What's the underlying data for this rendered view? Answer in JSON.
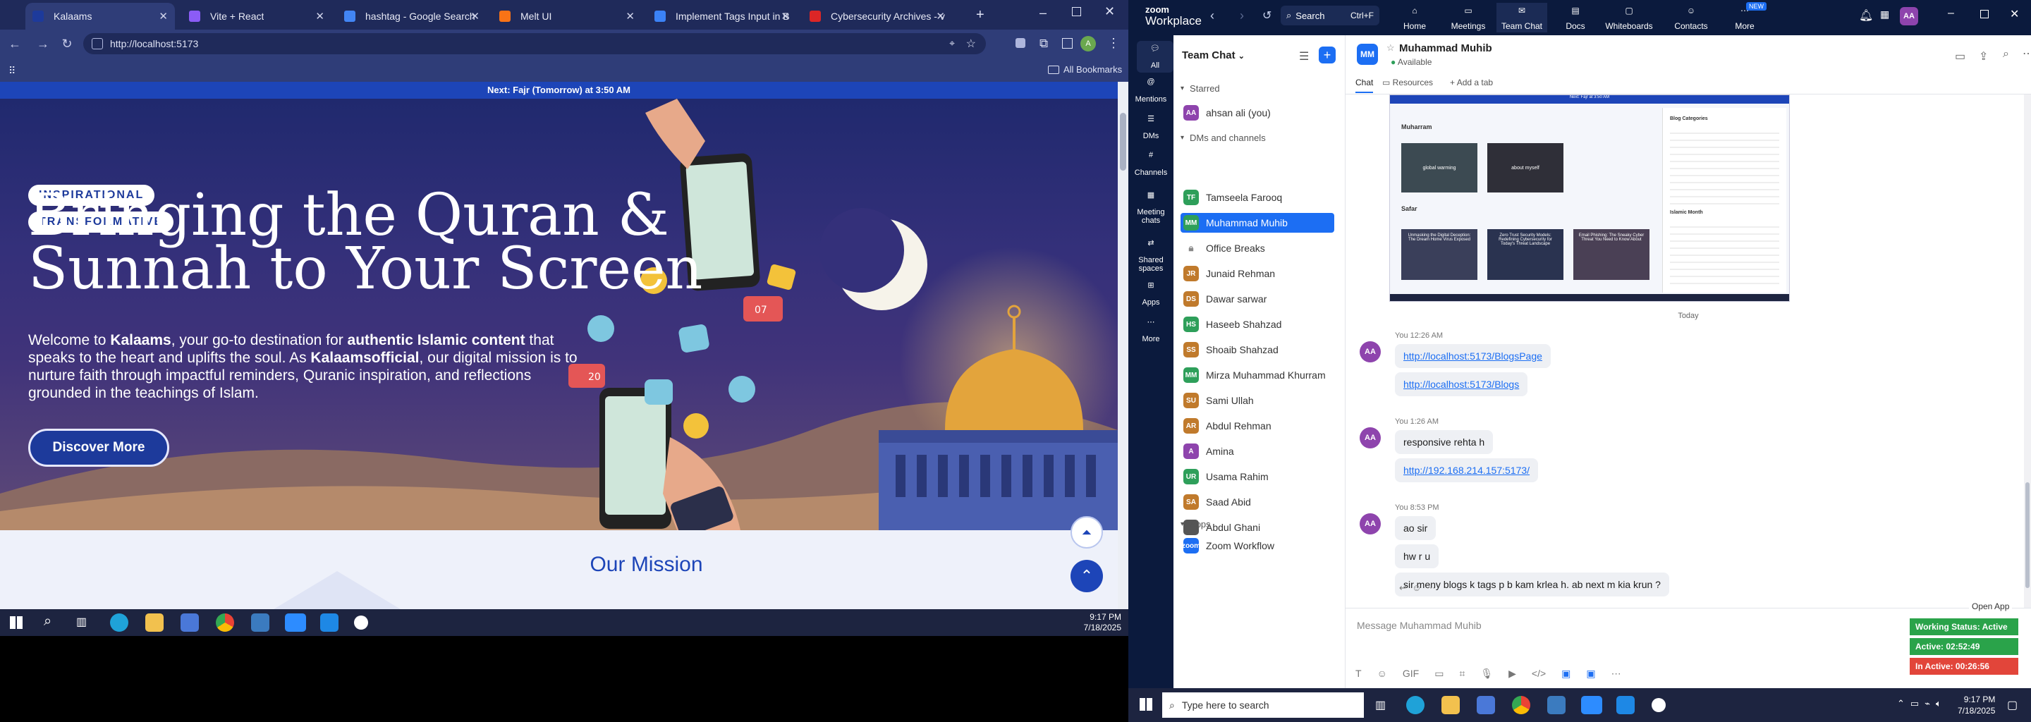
{
  "browser": {
    "tabs": [
      {
        "label": "Kalaams",
        "color": "#1d3a9b",
        "active": true
      },
      {
        "label": "Vite + React",
        "color": "#8b5cf6",
        "active": false
      },
      {
        "label": "hashtag - Google Search",
        "color": "#4285f4",
        "active": false
      },
      {
        "label": "Melt UI",
        "color": "#f97316",
        "active": false
      },
      {
        "label": "Implement Tags Input in Blo",
        "color": "#3b82f6",
        "active": false
      },
      {
        "label": "Cybersecurity Archives - vCi",
        "color": "#dc2626",
        "active": false
      }
    ],
    "url": "http://localhost:5173",
    "bookmarks_label": "All Bookmarks"
  },
  "site": {
    "banner": "Next: Fajr (Tomorrow) at 3:50 AM",
    "pill1": "INSPIRATIONAL",
    "pill2": "TRANSFORMATIVE",
    "title_line1": "Bringing the Quran &",
    "title_line2": "Sunnah to Your Screen",
    "intro_t1": "Welcome to ",
    "intro_b1": "Kalaams",
    "intro_t2": ", your go-to destination for ",
    "intro_b2": "authentic Islamic content",
    "intro_t3": " that speaks to the heart and uplifts the soul. As ",
    "intro_b3": "Kalaamsofficial",
    "intro_t4": ", our digital mission is to nurture faith through impactful reminders, Quranic inspiration, and reflections grounded in the teachings of Islam.",
    "cta": "Discover More",
    "mission_title": "Our Mission",
    "badge_like": "20",
    "badge_heart": "07"
  },
  "win_taskbar_left": {
    "time": "9:17 PM",
    "date": "7/18/2025"
  },
  "zoom": {
    "brand_top": "zoom",
    "brand_bottom": "Workplace",
    "search": "Search",
    "search_shortcut": "Ctrl+F",
    "nav": [
      "Home",
      "Meetings",
      "Team Chat",
      "Docs",
      "Whiteboards",
      "Contacts",
      "More"
    ],
    "nav_new": "NEW",
    "user_initials": "AA",
    "side": [
      "All",
      "Mentions",
      "DMs",
      "Channels",
      "Meeting chats",
      "Shared spaces",
      "Apps",
      "More"
    ],
    "list_title": "Team Chat",
    "starred": "Starred",
    "me": "ahsan ali (you)",
    "dms_label": "DMs and channels",
    "contacts": [
      {
        "name": "Tamseela Farooq",
        "init": "TF",
        "color": "#2e9f5a"
      },
      {
        "name": "Muhammad Muhib",
        "init": "MM",
        "color": "#2e9f5a",
        "selected": true
      },
      {
        "name": "Office Breaks",
        "init": "",
        "color": "#888",
        "lock": true
      },
      {
        "name": "Junaid Rehman",
        "init": "JR",
        "color": "#c07a2c"
      },
      {
        "name": "Dawar sarwar",
        "init": "DS",
        "color": "#c07a2c"
      },
      {
        "name": "Haseeb Shahzad",
        "init": "HS",
        "color": "#2e9f5a"
      },
      {
        "name": "Shoaib Shahzad",
        "init": "SS",
        "color": "#c07a2c"
      },
      {
        "name": "Mirza Muhammad Khurram",
        "init": "MM",
        "color": "#2e9f5a"
      },
      {
        "name": "Sami Ullah",
        "init": "SU",
        "color": "#c07a2c"
      },
      {
        "name": "Abdul Rehman",
        "init": "AR",
        "color": "#c07a2c"
      },
      {
        "name": "Amina",
        "init": "A",
        "color": "#8e44ad"
      },
      {
        "name": "Usama Rahim",
        "init": "UR",
        "color": "#2e9f5a"
      },
      {
        "name": "Saad Abid",
        "init": "SA",
        "color": "#c07a2c"
      },
      {
        "name": "Abdul Ghani",
        "init": "",
        "color": "#555"
      }
    ],
    "apps_label": "Apps",
    "app_item": "Zoom Workflow",
    "chat_name": "Muhammad Muhib",
    "chat_init": "MM",
    "chat_status": "Available",
    "chat_tabs": [
      "Chat",
      "Resources",
      "Add a tab"
    ],
    "day_label": "Today",
    "messages": [
      {
        "meta": "You 12:26 AM",
        "lines": [
          "http://localhost:5173/BlogsPage",
          "http://localhost:5173/Blogs"
        ],
        "links": true
      },
      {
        "meta": "You 1:26 AM",
        "lines": [
          "responsive rehta h",
          "http://192.168.214.157:5173/"
        ],
        "links": false
      },
      {
        "meta": "You 8:53 PM",
        "lines": [
          "ao sir",
          "hw r u",
          "sir meny blogs k tags p b kam krlea h. ab next m kia krun ?"
        ],
        "links": false
      }
    ],
    "shot": {
      "heading": "Muharram",
      "card1": "global warming",
      "card2": "about myself",
      "sub": "Safar",
      "cards": [
        "Unmasking the Digital Deception: The Dream Home Virus Exposed",
        "Zero Trust Security Models: Redefining Cybersecurity for Today's Threat Landscape",
        "Email Phishing: The Sneaky Cyber Threat You Need to Know About"
      ],
      "side1": "Blog Categories",
      "side2": "Islamic Month",
      "top": "Next: Fajr at 3:50 AM"
    },
    "compose_placeholder": "Message Muhammad Muhib",
    "open_app": "Open App",
    "working_status": "Working Status: Active",
    "active_time": "Active: 02:52:49",
    "inactive_time": "In Active: 00:26:56",
    "search_taskbar": "Type here to search",
    "time": "9:17 PM",
    "date": "7/18/2025"
  }
}
